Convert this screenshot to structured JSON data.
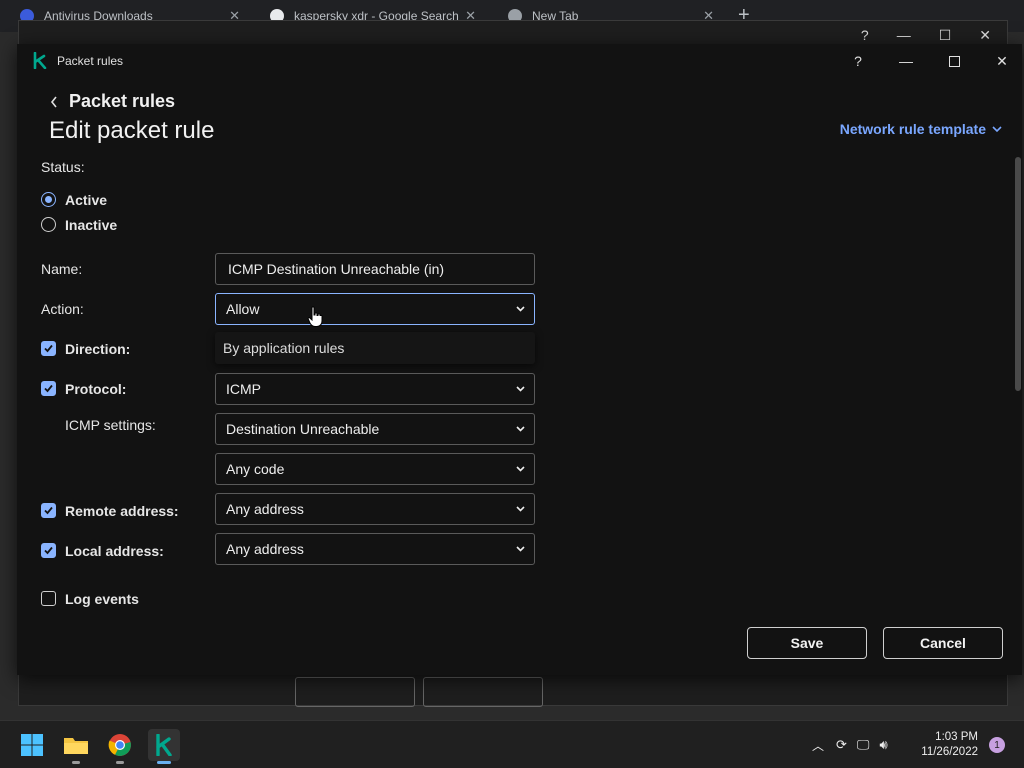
{
  "browser": {
    "tabs": [
      {
        "label": "Antivirus Downloads"
      },
      {
        "label": "kaspersky xdr - Google Search"
      },
      {
        "label": "New Tab"
      }
    ]
  },
  "dialog": {
    "app_title": "Packet rules",
    "breadcrumb": "Packet rules",
    "page_title": "Edit packet rule",
    "template_link": "Network rule template",
    "help_glyph": "?"
  },
  "form": {
    "status_label": "Status:",
    "status_options": [
      {
        "label": "Active",
        "selected": true
      },
      {
        "label": "Inactive",
        "selected": false
      }
    ],
    "name_label": "Name:",
    "name_value": "ICMP Destination Unreachable (in)",
    "action_label": "Action:",
    "action_value": "Allow",
    "action_dropdown_option": "By application rules",
    "direction_label": "Direction:",
    "direction_checked": true,
    "protocol_label": "Protocol:",
    "protocol_checked": true,
    "protocol_value": "ICMP",
    "icmp_label": "ICMP settings:",
    "icmp_type_value": "Destination Unreachable",
    "icmp_code_value": "Any code",
    "remote_label": "Remote address:",
    "remote_checked": true,
    "remote_value": "Any address",
    "local_label": "Local address:",
    "local_checked": true,
    "local_value": "Any address",
    "log_label": "Log events",
    "log_checked": false
  },
  "buttons": {
    "save": "Save",
    "cancel": "Cancel"
  },
  "taskbar": {
    "time": "1:03 PM",
    "date": "11/26/2022",
    "notifications": "1"
  },
  "colors": {
    "accent": "#8ab4ff",
    "link": "#7aa7ff",
    "dialog_bg": "#121212",
    "kaspersky_green": "#00a88e"
  }
}
